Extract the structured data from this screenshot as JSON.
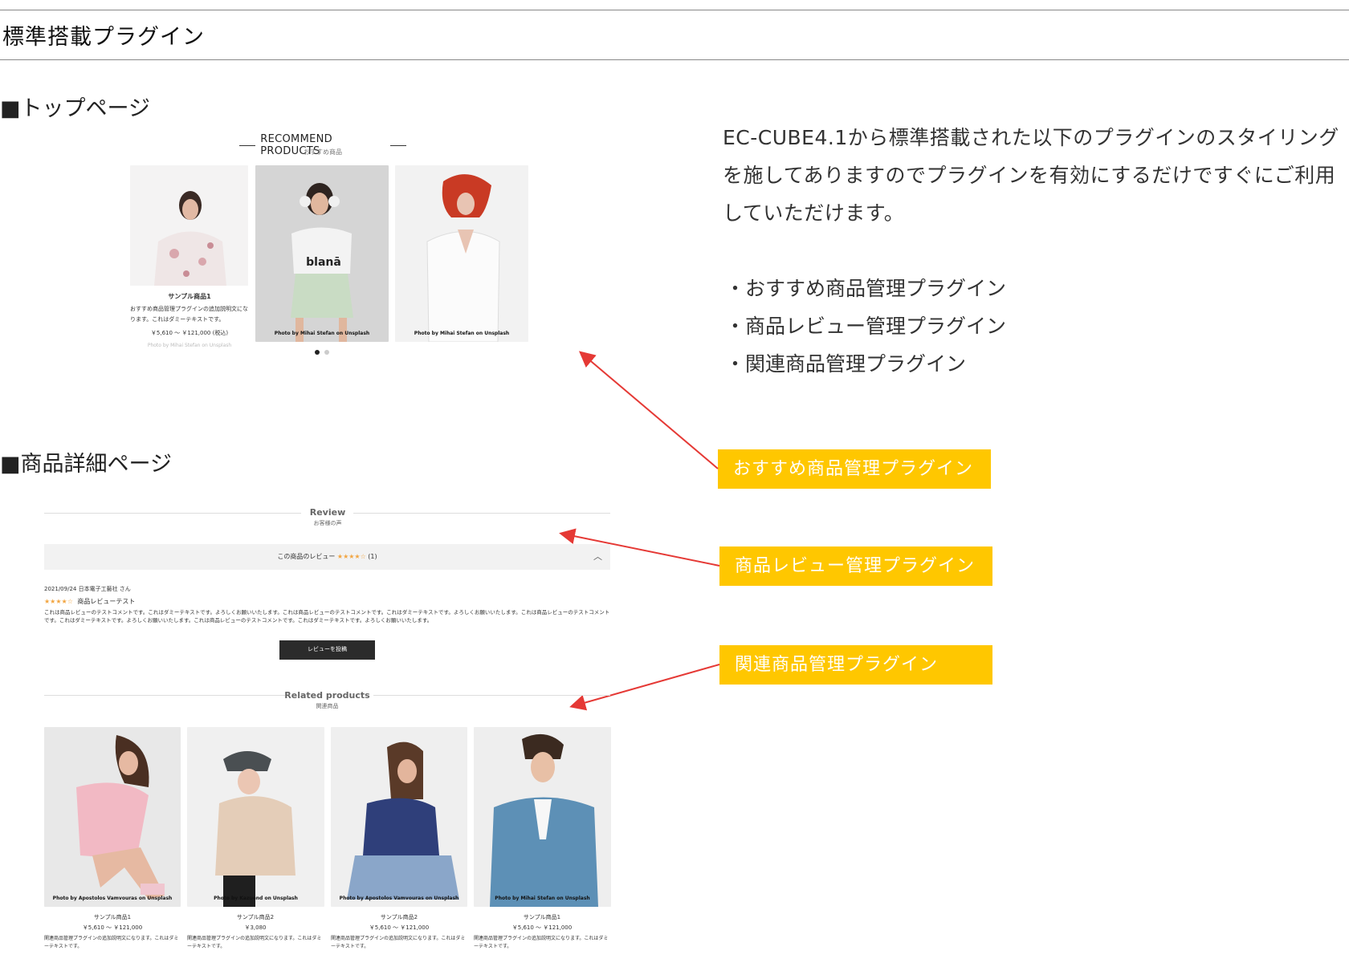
{
  "page": {
    "title": "標準搭載プラグイン",
    "top_heading": "■トップページ",
    "detail_heading": "■商品詳細ページ"
  },
  "recommend": {
    "title": "RECOMMEND PRODUCTS",
    "subtitle": "おすすめ商品",
    "cards": [
      {
        "name": "サンプル商品1",
        "desc": "おすすめ商品管理プラグインの追加説明文になります。これはダミーテキストです。",
        "price": "￥5,610 ～ ￥121,000",
        "tax": "(税込)",
        "credit": "Photo by Mihai Stefan on Unsplash"
      },
      {
        "credit": "Photo by Mihai Stefan on Unsplash"
      },
      {
        "credit": "Photo by Mihai Stefan on Unsplash"
      }
    ]
  },
  "intro": {
    "text": "EC-CUBE4.1から標準搭載された以下のプラグインのスタイリングを施してありますのでプラグインを有効にするだけですぐにご利用していただけます。",
    "plugins": [
      "・おすすめ商品管理プラグイン",
      "・商品レビュー管理プラグイン",
      "・関連商品管理プラグイン"
    ]
  },
  "callouts": [
    "おすすめ商品管理プラグイン",
    "商品レビュー管理プラグイン",
    "関連商品管理プラグイン"
  ],
  "review": {
    "title": "Review",
    "subtitle": "お客様の声",
    "bar_label": "この商品のレビュー",
    "bar_stars": "★★★★☆",
    "bar_count": "(1)",
    "date_author": "2021/09/24 日本電子工藝社 さん",
    "stars": "★★★★☆",
    "headline": "商品レビューテスト",
    "body": "これは商品レビューのテストコメントです。これはダミーテキストです。よろしくお願いいたします。これは商品レビューのテストコメントです。これはダミーテキストです。よろしくお願いいたします。これは商品レビューのテストコメントです。これはダミーテキストです。よろしくお願いいたします。これは商品レビューのテストコメントです。これはダミーテキストです。よろしくお願いいたします。",
    "button": "レビューを投稿"
  },
  "related": {
    "title": "Related products",
    "subtitle": "関連商品",
    "items": [
      {
        "name": "サンプル商品1",
        "price": "￥5,610 ～ ￥121,000",
        "desc": "関連商品管理プラグインの追加説明文になります。これはダミーテキストです。",
        "credit": "Photo by Apostolos Vamvouras on Unsplash"
      },
      {
        "name": "サンプル商品2",
        "price": "￥3,080",
        "desc": "関連商品管理プラグインの追加説明文になります。これはダミーテキストです。",
        "credit": "Photo by Kazuend on Unsplash"
      },
      {
        "name": "サンプル商品2",
        "price": "￥5,610 ～ ￥121,000",
        "desc": "関連商品管理プラグインの追加説明文になります。これはダミーテキストです。",
        "credit": "Photo by Apostolos Vamvouras on Unsplash"
      },
      {
        "name": "サンプル商品1",
        "price": "￥5,610 ～ ￥121,000",
        "desc": "関連商品管理プラグインの追加説明文になります。これはダミーテキストです。",
        "credit": "Photo by Mihai Stefan on Unsplash"
      }
    ]
  },
  "colors": {
    "callout": "#FFC700",
    "arrow": "#E53935",
    "button": "#2B2B2B",
    "stars": "#F2A541"
  }
}
